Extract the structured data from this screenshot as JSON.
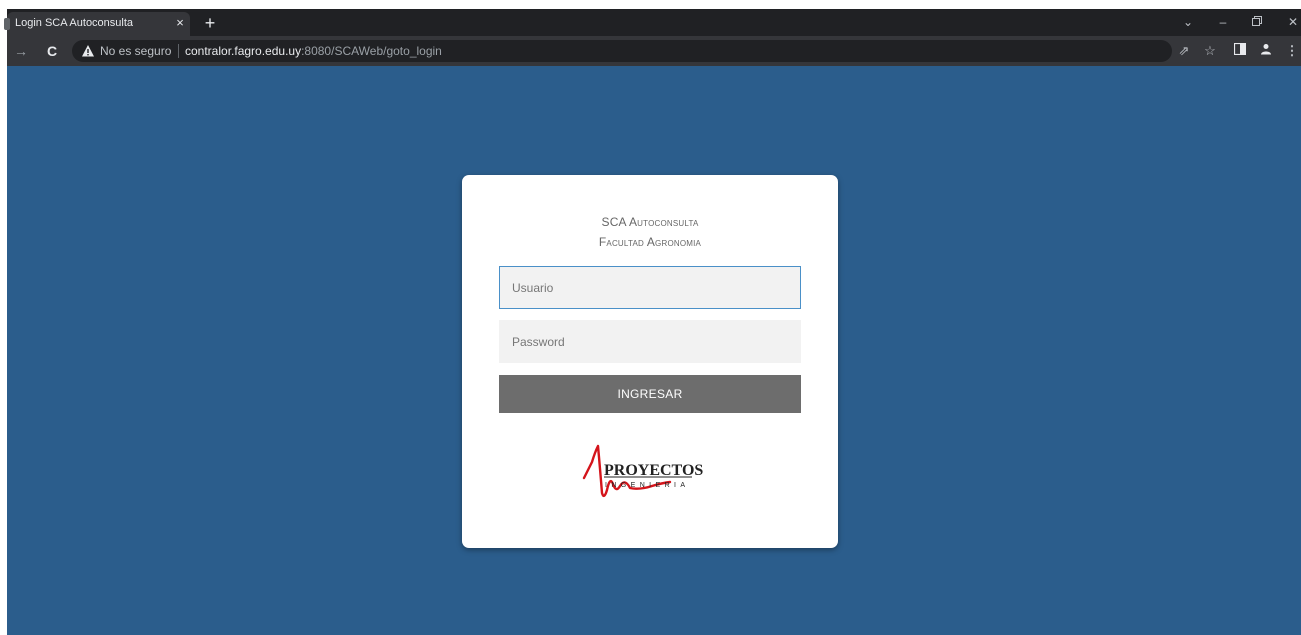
{
  "browser": {
    "tab_title": "Login SCA Autoconsulta",
    "tab_close": "×",
    "new_tab": "+",
    "security_label": "No es seguro",
    "url_host": "contralor.fagro.edu.uy",
    "url_rest": ":8080/SCAWeb/goto_login",
    "icons": [
      "back-arrow-icon",
      "reload-icon",
      "warning-icon",
      "share-icon",
      "star-icon",
      "sidepanel-icon",
      "profile-icon",
      "menu-icon",
      "tab-search-icon",
      "minimize-icon",
      "restore-icon",
      "close-window-icon"
    ]
  },
  "login": {
    "title_line1": "SCA Autoconsulta",
    "title_line2": "Facultad Agronomia",
    "username_placeholder": "Usuario",
    "password_placeholder": "Password",
    "submit_label": "INGRESAR",
    "logo_text": "PROYECTOS",
    "logo_subtext": "INGENIERIA"
  },
  "colors": {
    "background": "#2b5d8c",
    "card": "#ffffff",
    "button": "#6d6d6d",
    "logo_red": "#d4141b"
  }
}
